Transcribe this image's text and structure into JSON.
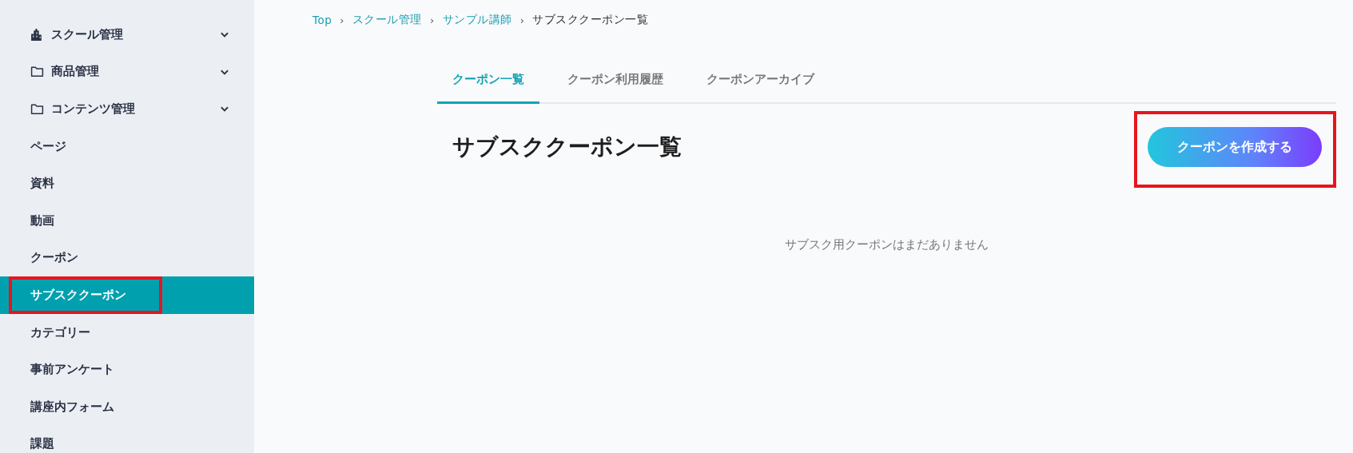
{
  "sidebar": {
    "items": [
      {
        "label": "スクール管理",
        "kind": "building",
        "expandable": true,
        "selected": false,
        "highlighted": false
      },
      {
        "label": "商品管理",
        "kind": "folder",
        "expandable": true,
        "selected": false,
        "highlighted": false
      },
      {
        "label": "コンテンツ管理",
        "kind": "folder",
        "expandable": true,
        "selected": false,
        "highlighted": false
      },
      {
        "label": "ページ",
        "kind": "plain",
        "expandable": false,
        "selected": false,
        "highlighted": false
      },
      {
        "label": "資料",
        "kind": "plain",
        "expandable": false,
        "selected": false,
        "highlighted": false
      },
      {
        "label": "動画",
        "kind": "plain",
        "expandable": false,
        "selected": false,
        "highlighted": false
      },
      {
        "label": "クーポン",
        "kind": "plain",
        "expandable": false,
        "selected": false,
        "highlighted": false
      },
      {
        "label": "サブスククーポン",
        "kind": "plain",
        "expandable": false,
        "selected": true,
        "highlighted": true
      },
      {
        "label": "カテゴリー",
        "kind": "plain",
        "expandable": false,
        "selected": false,
        "highlighted": false
      },
      {
        "label": "事前アンケート",
        "kind": "plain",
        "expandable": false,
        "selected": false,
        "highlighted": false
      },
      {
        "label": "講座内フォーム",
        "kind": "plain",
        "expandable": false,
        "selected": false,
        "highlighted": false
      },
      {
        "label": "課題",
        "kind": "plain",
        "expandable": false,
        "selected": false,
        "highlighted": false
      }
    ]
  },
  "breadcrumb": [
    {
      "label": "Top",
      "kind": "link"
    },
    {
      "label": "›",
      "kind": "separator"
    },
    {
      "label": "スクール管理",
      "kind": "link"
    },
    {
      "label": "›",
      "kind": "separator"
    },
    {
      "label": "サンプル講師",
      "kind": "link"
    },
    {
      "label": "›",
      "kind": "separator"
    },
    {
      "label": "サブスククーポン一覧",
      "kind": "current"
    }
  ],
  "tabs": [
    {
      "label": "クーポン一覧",
      "selected": true
    },
    {
      "label": "クーポン利用履歴",
      "selected": false
    },
    {
      "label": "クーポンアーカイブ",
      "selected": false
    }
  ],
  "page_title": "サブスククーポン一覧",
  "create_button": {
    "label": "クーポンを作成する",
    "highlighted": true
  },
  "empty_message": "サブスク用クーポンはまだありません"
}
